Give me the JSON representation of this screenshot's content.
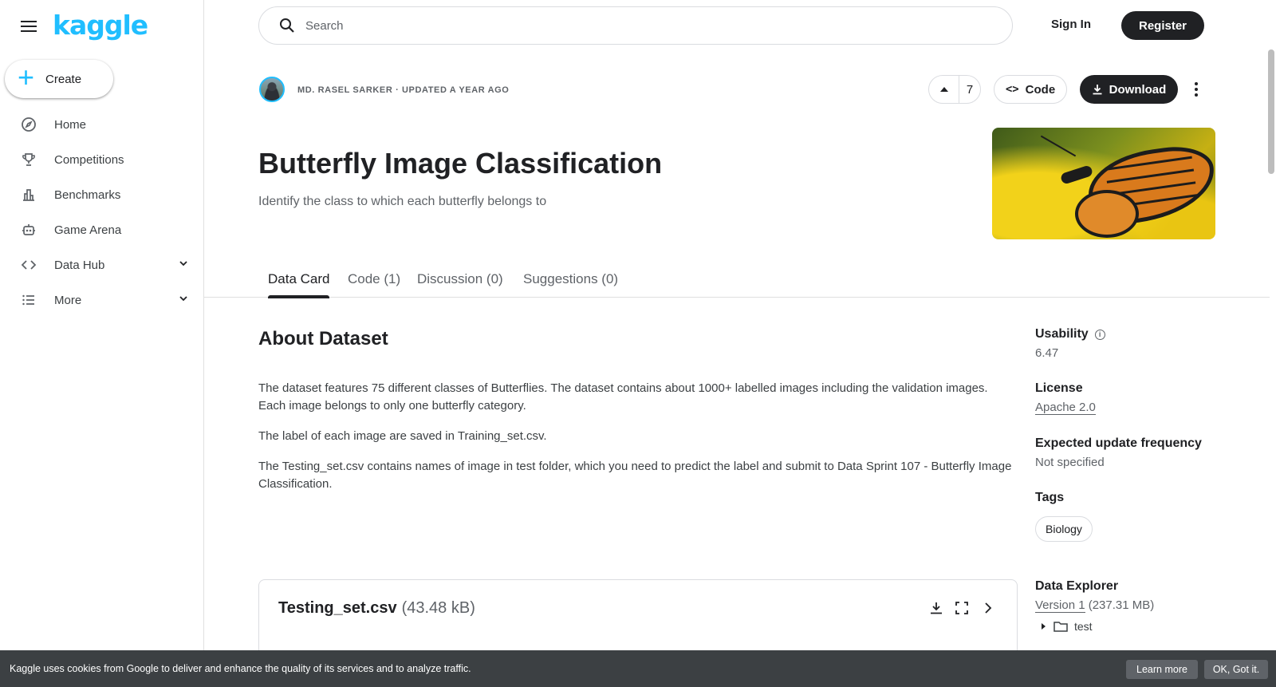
{
  "brand": {
    "logo_text": "kaggle",
    "accent": "#20BEFF"
  },
  "sidebar": {
    "create_label": "Create",
    "items": [
      {
        "label": "Home",
        "icon": "compass-icon"
      },
      {
        "label": "Competitions",
        "icon": "trophy-icon"
      },
      {
        "label": "Benchmarks",
        "icon": "bar-chart-icon"
      },
      {
        "label": "Game Arena",
        "icon": "robot-icon"
      },
      {
        "label": "Data Hub",
        "icon": "code-brackets-icon",
        "expandable": true
      },
      {
        "label": "More",
        "icon": "list-icon",
        "expandable": true
      }
    ]
  },
  "header": {
    "search_placeholder": "Search",
    "signin_label": "Sign In",
    "register_label": "Register"
  },
  "dataset": {
    "author_line": "MD. RASEL SARKER · UPDATED A YEAR AGO",
    "vote_count": "7",
    "code_label": "Code",
    "download_label": "Download",
    "title": "Butterfly Image Classification",
    "subtitle": "Identify the class to which each butterfly belongs to"
  },
  "tabs": [
    {
      "label": "Data Card",
      "active": true
    },
    {
      "label": "Code (1)",
      "active": false
    },
    {
      "label": "Discussion (0)",
      "active": false
    },
    {
      "label": "Suggestions (0)",
      "active": false
    }
  ],
  "about": {
    "heading": "About Dataset",
    "paragraphs": [
      "The dataset features 75 different classes of Butterflies. The dataset contains about 1000+ labelled images including the validation images. Each image belongs to only one butterfly category.",
      "The label of each image are saved in Training_set.csv.",
      "The Testing_set.csv contains names of image in test folder, which you need to predict the label and submit to Data Sprint 107 - Butterfly Image Classification."
    ]
  },
  "meta": {
    "usability_label": "Usability",
    "usability_value": "6.47",
    "license_label": "License",
    "license_value": "Apache 2.0",
    "frequency_label": "Expected update frequency",
    "frequency_value": "Not specified",
    "tags_label": "Tags",
    "tag_1": "Biology",
    "explorer_label": "Data Explorer",
    "version_link": "Version 1",
    "version_size": "(237.31 MB)",
    "tree_folder": "test"
  },
  "file_card": {
    "name": "Testing_set.csv",
    "size": "(43.48 kB)"
  },
  "cookie": {
    "text": "Kaggle uses cookies from Google to deliver and enhance the quality of its services and to analyze traffic.",
    "learn_more": "Learn more",
    "ok": "OK, Got it."
  }
}
